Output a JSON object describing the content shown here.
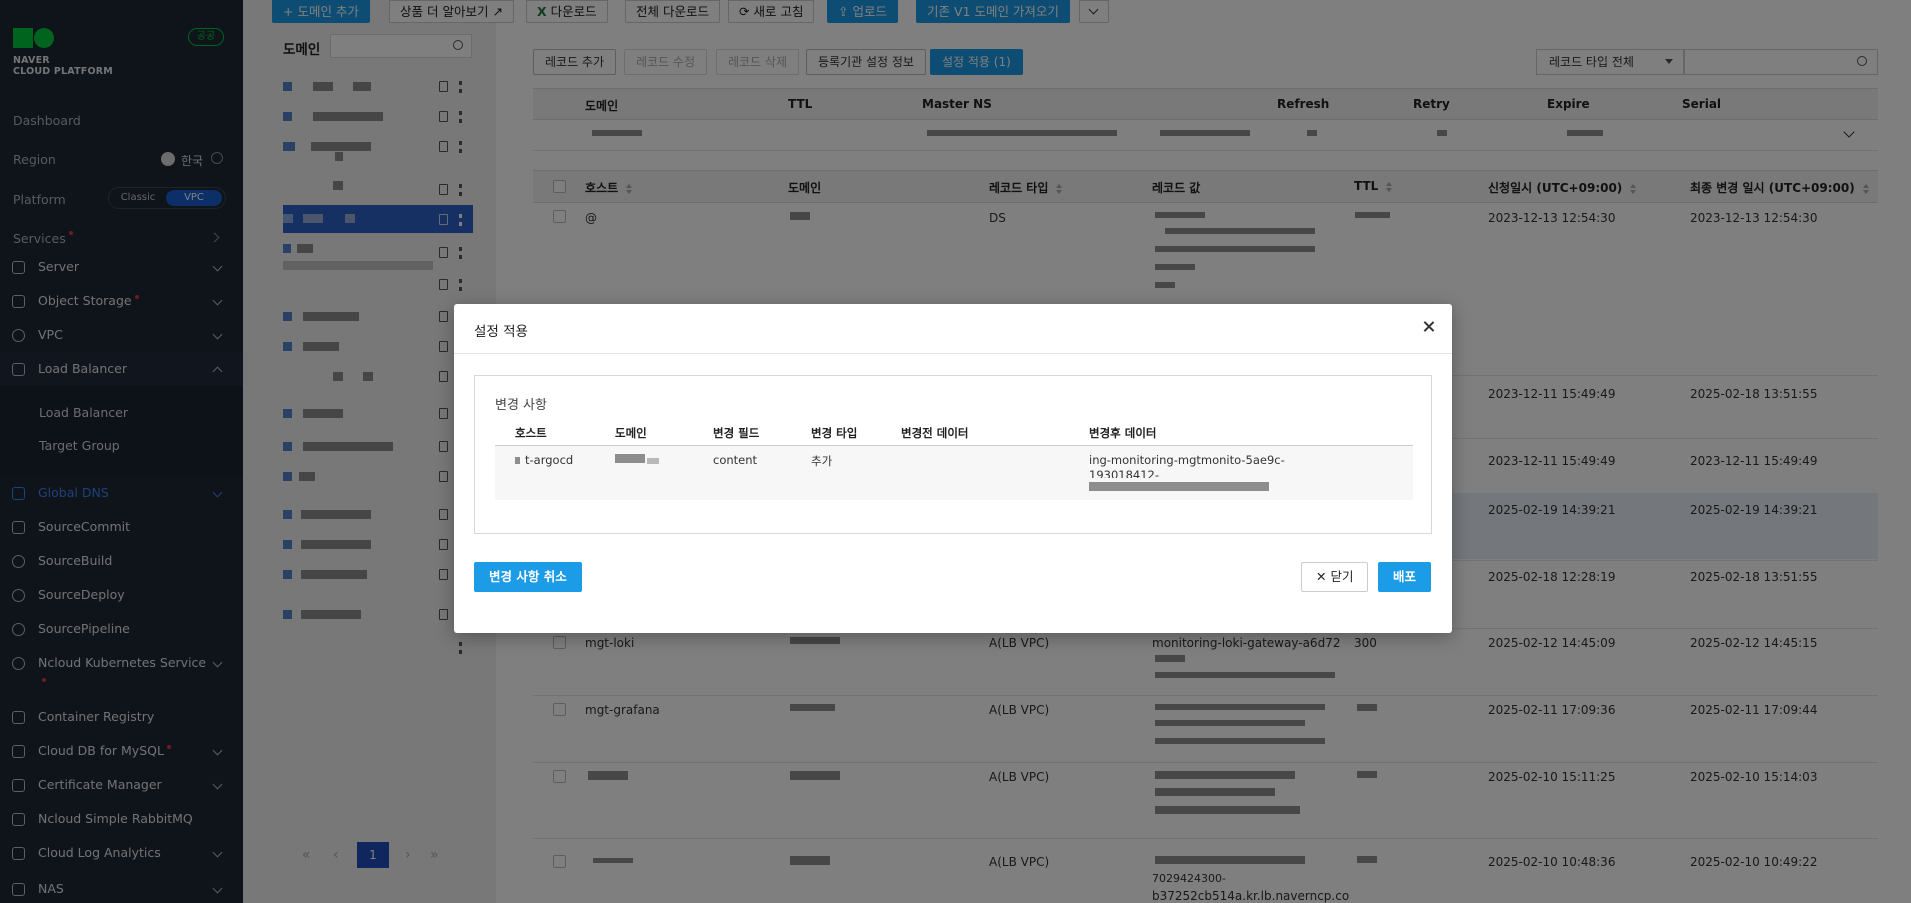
{
  "sidebar": {
    "logo_line1": "NAVER",
    "logo_line2": "CLOUD PLATFORM",
    "public_badge": "공공",
    "dashboard": "Dashboard",
    "region_label": "Region",
    "region_value": "한국",
    "platform_label": "Platform",
    "platform_classic": "Classic",
    "platform_vpc": "VPC",
    "services_label": "Services",
    "items": [
      {
        "label": "Server",
        "icon": "server-icon"
      },
      {
        "label": "Object Storage",
        "icon": "storage-icon"
      },
      {
        "label": "VPC",
        "icon": "vpc-icon"
      },
      {
        "label": "Load Balancer",
        "icon": "load-balancer-icon"
      }
    ],
    "sub_items": [
      "Load Balancer",
      "Target Group"
    ],
    "items2": [
      {
        "label": "Global DNS",
        "icon": "dns-icon"
      },
      {
        "label": "SourceCommit",
        "icon": "source-commit-icon"
      },
      {
        "label": "SourceBuild",
        "icon": "source-build-icon"
      },
      {
        "label": "SourceDeploy",
        "icon": "source-deploy-icon"
      },
      {
        "label": "SourcePipeline",
        "icon": "source-pipeline-icon"
      },
      {
        "label": "Ncloud Kubernetes Service",
        "icon": "kubernetes-icon"
      },
      {
        "label": "Container Registry",
        "icon": "container-registry-icon"
      },
      {
        "label": "Cloud DB for MySQL",
        "icon": "database-icon"
      },
      {
        "label": "Certificate Manager",
        "icon": "certificate-icon"
      },
      {
        "label": "Ncloud Simple RabbitMQ",
        "icon": "rabbitmq-icon"
      },
      {
        "label": "Cloud Log Analytics",
        "icon": "log-analytics-icon"
      },
      {
        "label": "NAS",
        "icon": "nas-icon"
      }
    ]
  },
  "toolbar": {
    "add_domain": "+ 도메인 추가",
    "learn_more": "상품 더 알아보기",
    "download": "다운로드",
    "download_all": "전체 다운로드",
    "refresh": "새로 고침",
    "upload": "업로드",
    "import_v1": "기존 V1 도메인 가져오기"
  },
  "domain_panel": {
    "title": "도메인",
    "page_current": "1"
  },
  "record_toolbar": {
    "add": "레코드 추가",
    "edit": "레코드 수정",
    "delete": "레코드 삭제",
    "registrar": "등록기관 설정 정보",
    "apply": "설정 적용 (1)",
    "type_select": "레코드 타입 전체"
  },
  "soa_table": {
    "headers": [
      "도메인",
      "TTL",
      "Master NS",
      "Refresh",
      "Retry",
      "Expire",
      "Serial"
    ]
  },
  "record_table": {
    "headers": [
      "호스트",
      "도메인",
      "레코드 타입",
      "레코드 값",
      "TTL",
      "신청일시 (UTC+09:00)",
      "최종 변경 일시 (UTC+09:00)"
    ],
    "rows": [
      {
        "host": "@",
        "type": "DS",
        "ttl": "",
        "created": "2023-12-13 12:54:30",
        "modified": "2023-12-13 12:54:30"
      },
      {
        "host": "",
        "type": "",
        "ttl": "",
        "created": "2023-12-11 15:49:49",
        "modified": "2025-02-18 13:51:55"
      },
      {
        "host": "",
        "type": "",
        "ttl": "",
        "created": "2023-12-11 15:49:49",
        "modified": "2023-12-11 15:49:49"
      },
      {
        "host": "",
        "type": "",
        "ttl": "",
        "created": "2025-02-19 14:39:21",
        "modified": "2025-02-19 14:39:21"
      },
      {
        "host": "",
        "type": "",
        "ttl": "",
        "created": "2025-02-18 12:28:19",
        "modified": "2025-02-18 13:51:55"
      },
      {
        "host": "mgt-loki",
        "type": "A(LB VPC)",
        "value": "monitoring-loki-gateway-a6d72",
        "ttl": "300",
        "created": "2025-02-12 14:45:09",
        "modified": "2025-02-12 14:45:15"
      },
      {
        "host": "mgt-grafana",
        "type": "A(LB VPC)",
        "ttl": "",
        "created": "2025-02-11 17:09:36",
        "modified": "2025-02-11 17:09:44"
      },
      {
        "host": "",
        "type": "A(LB VPC)",
        "ttl": "",
        "created": "2025-02-10 15:11:25",
        "modified": "2025-02-10 15:14:03"
      },
      {
        "host": "",
        "type": "A(LB VPC)",
        "value": "b37252cb514a.kr.lb.naverncp.co",
        "value_pre": "7029424300-",
        "ttl": "",
        "created": "2025-02-10 10:48:36",
        "modified": "2025-02-10 10:49:22"
      }
    ]
  },
  "modal": {
    "title": "설정 적용",
    "box_title": "변경 사항",
    "headers": [
      "호스트",
      "도메인",
      "변경 필드",
      "변경 타입",
      "변경전 데이터",
      "변경후 데이터"
    ],
    "row": {
      "host": "t-argocd",
      "field": "content",
      "change_type": "추가",
      "before": "",
      "after_line1": "ing-monitoring-mgtmonito-5ae9c-",
      "after_line2": "193018412-"
    },
    "cancel_changes": "변경 사항 취소",
    "close": "닫기",
    "deploy": "배포"
  }
}
